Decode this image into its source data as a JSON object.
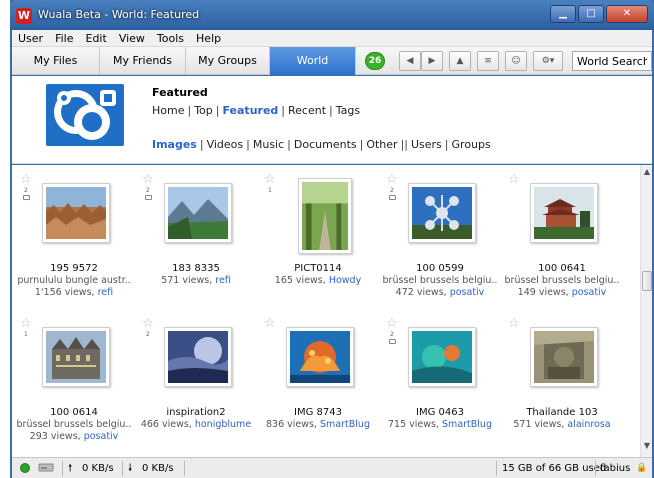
{
  "window": {
    "title": "Wuala Beta - World: Featured",
    "app_icon": "wuala-logo-icon",
    "buttons": [
      "minimize",
      "maximize",
      "close"
    ]
  },
  "menu": [
    "User",
    "File",
    "Edit",
    "View",
    "Tools",
    "Help"
  ],
  "tabs": [
    {
      "label": "My Files",
      "active": false
    },
    {
      "label": "My Friends",
      "active": false
    },
    {
      "label": "My Groups",
      "active": false
    },
    {
      "label": "World",
      "active": true
    }
  ],
  "notification_count": "26",
  "toolbar_icons": [
    "back-icon",
    "forward-icon",
    "up-icon",
    "details-icon",
    "people-icon",
    "gear-icon"
  ],
  "search": {
    "value": "World Search"
  },
  "header": {
    "title": "Featured",
    "nav": [
      "Home",
      "Top",
      "Featured",
      "Recent",
      "Tags"
    ],
    "nav_selected": "Featured",
    "filters_a": [
      "Images",
      "Videos",
      "Music",
      "Documents",
      "Other"
    ],
    "filters_b": [
      "Users",
      "Groups"
    ],
    "filter_selected": "Images"
  },
  "items": [
    {
      "title": "195 9572",
      "desc": "purnululu bungle austr..",
      "views": "1'156 views, ",
      "user": "refi",
      "rating": "2",
      "comment": true,
      "img": "rocks"
    },
    {
      "title": "183 8335",
      "desc": "",
      "views": "571 views, ",
      "user": "refi",
      "rating": "2",
      "comment": true,
      "img": "valley"
    },
    {
      "title": "PICT0114",
      "desc": "",
      "views": "165 views, ",
      "user": "Howdy",
      "rating": "1",
      "comment": false,
      "img": "forest",
      "tall": true
    },
    {
      "title": "100 0599",
      "desc": "brüssel brussels belgiu..",
      "views": "472 views, ",
      "user": "posativ",
      "rating": "2",
      "comment": true,
      "img": "atomium"
    },
    {
      "title": "100 0641",
      "desc": "brüssel brussels belgiu..",
      "views": "149 views, ",
      "user": "posativ",
      "rating": "",
      "comment": false,
      "img": "pagoda"
    },
    {
      "title": "100 0614",
      "desc": "brüssel brussels belgiu..",
      "views": "293 views, ",
      "user": "posativ",
      "rating": "1",
      "comment": false,
      "img": "guildhall"
    },
    {
      "title": "inspiration2",
      "desc": "",
      "views": "466 views, ",
      "user": "honigblume",
      "rating": "2",
      "comment": false,
      "img": "sky"
    },
    {
      "title": "IMG 8743",
      "desc": "",
      "views": "836 views, ",
      "user": "SmartBlug",
      "rating": "",
      "comment": false,
      "img": "coral"
    },
    {
      "title": "IMG 0463",
      "desc": "",
      "views": "715 views, ",
      "user": "SmartBlug",
      "rating": "2",
      "comment": true,
      "img": "reef"
    },
    {
      "title": "Thailande 103",
      "desc": "",
      "views": "571 views, ",
      "user": "alainrosa",
      "rating": "",
      "comment": false,
      "img": "temple"
    }
  ],
  "status": {
    "upload": "0 KB/s",
    "download": "0 KB/s",
    "storage": "15 GB of 66 GB used",
    "user": "fabius"
  },
  "colors": {
    "accent": "#2b66c7",
    "tab_active": "#3d7fd8",
    "badge": "#3bb12a"
  }
}
